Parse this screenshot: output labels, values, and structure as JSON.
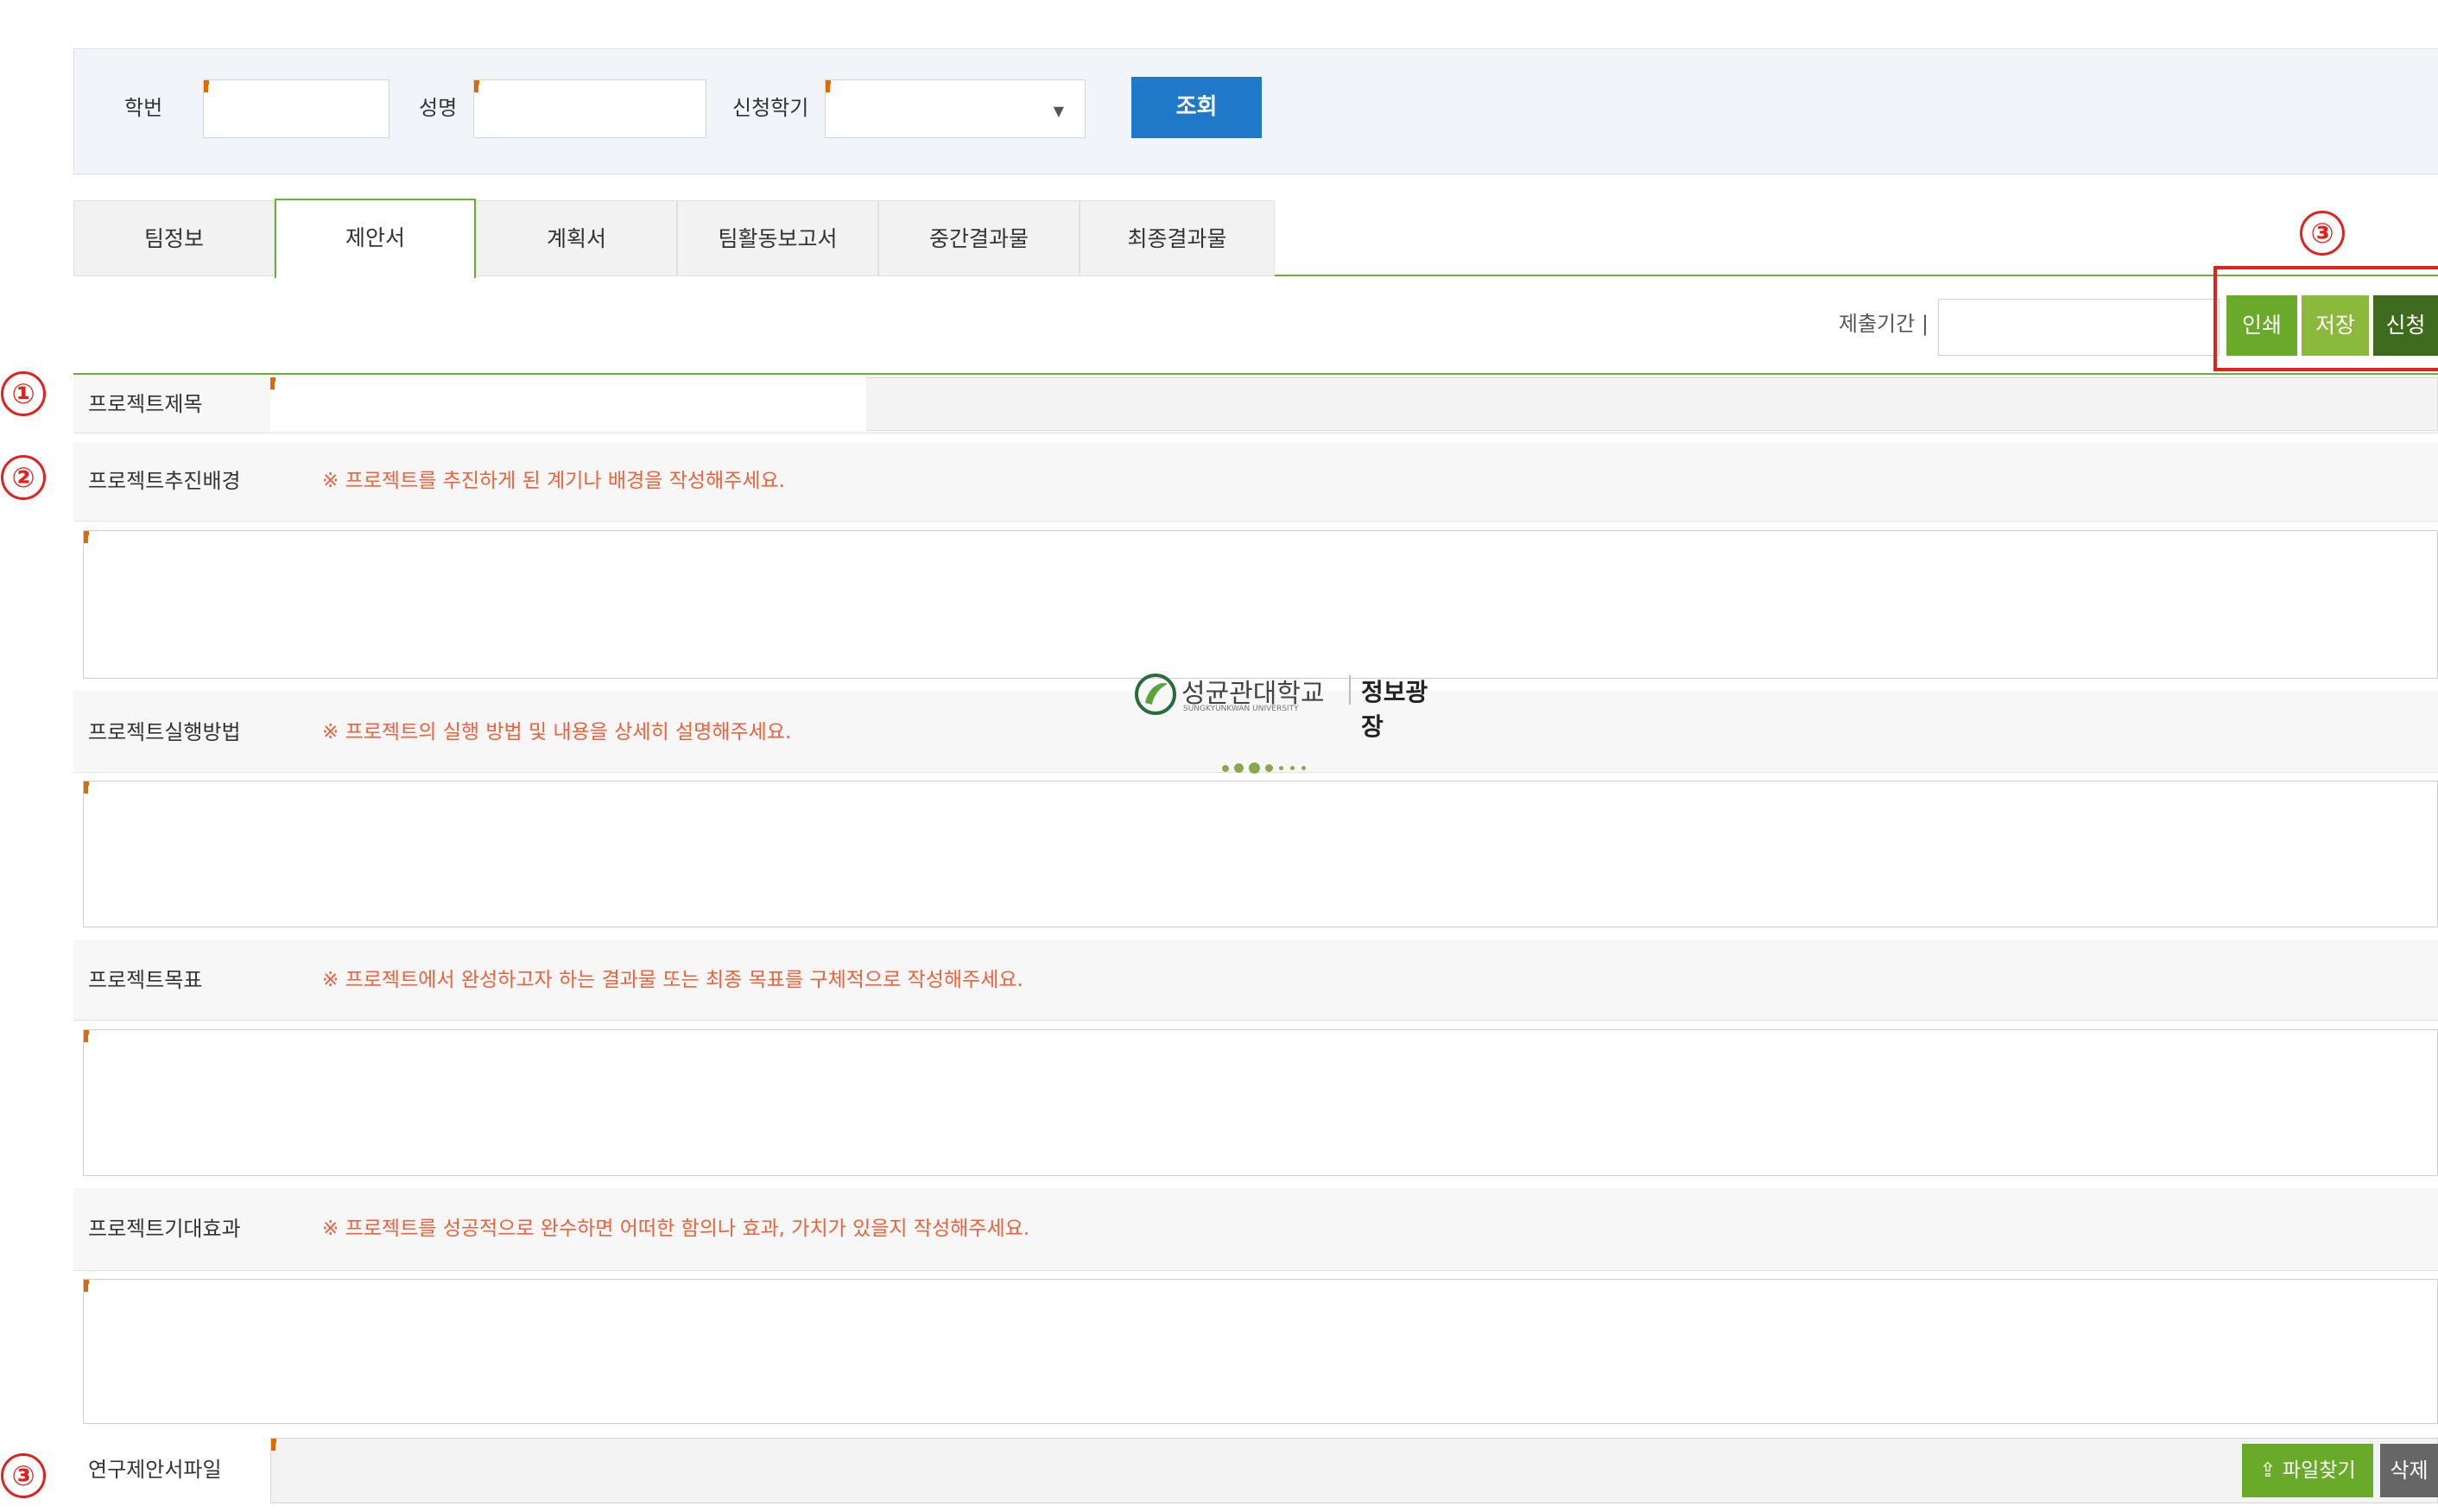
{
  "search": {
    "student_id_label": "학번",
    "name_label": "성명",
    "semester_label": "신청학기",
    "search_button": "조회",
    "semester_value": ""
  },
  "tabs": [
    {
      "label": "팀정보",
      "active": false
    },
    {
      "label": "제안서",
      "active": true
    },
    {
      "label": "계획서",
      "active": false
    },
    {
      "label": "팀활동보고서",
      "active": false
    },
    {
      "label": "중간결과물",
      "active": false
    },
    {
      "label": "최종결과물",
      "active": false
    }
  ],
  "toolbar": {
    "period_label": "제출기간",
    "print_button": "인쇄",
    "save_button": "저장",
    "apply_button": "신청"
  },
  "annotations": {
    "one": "①",
    "two": "②",
    "three": "③"
  },
  "form": {
    "title_label": "프로젝트제목",
    "background_label": "프로젝트추진배경",
    "background_hint": "※ 프로젝트를 추진하게 된 계기나 배경을 작성해주세요.",
    "method_label": "프로젝트실행방법",
    "method_hint": "※ 프로젝트의 실행 방법 및 내용을 상세히 설명해주세요.",
    "goal_label": "프로젝트목표",
    "goal_hint": "※ 프로젝트에서 완성하고자 하는 결과물 또는 최종 목표를 구체적으로 작성해주세요.",
    "effect_label": "프로젝트기대효과",
    "effect_hint": "※ 프로젝트를 성공적으로 완수하면 어떠한 함의나 효과, 가치가 있을지 작성해주세요.",
    "file_label": "연구제안서파일",
    "file_find_button": "파일찾기",
    "file_delete_button": "삭제"
  },
  "loading": {
    "university": "성균관대학교",
    "university_en": "SUNGKYUNKWAN UNIVERSITY",
    "portal": "정보광장"
  },
  "colors": {
    "accent_green": "#6cb033",
    "dark_green": "#3e6b1d",
    "primary_blue": "#1f78c8",
    "hint_orange": "#f0603a",
    "annotation_red": "#e3201b"
  }
}
